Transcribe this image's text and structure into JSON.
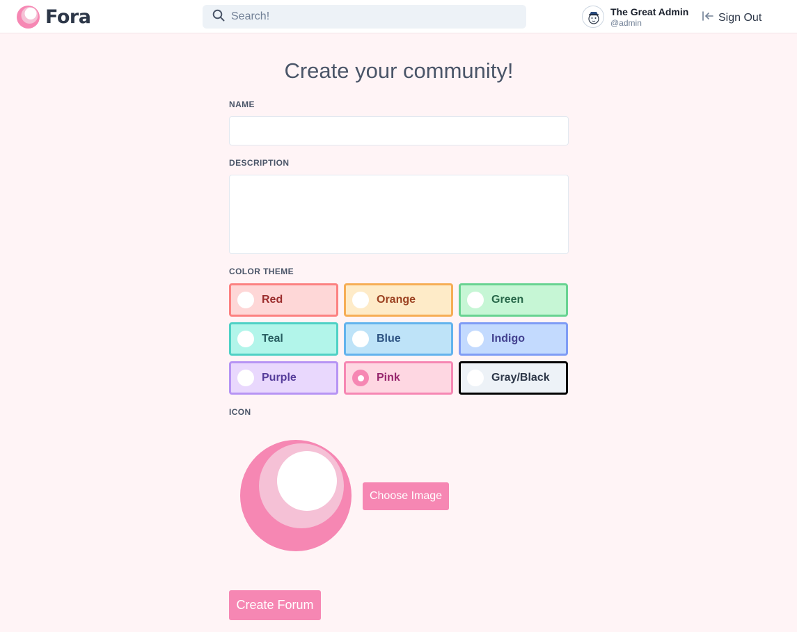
{
  "header": {
    "logo_text": "Fora",
    "logo_icon": "fora-logo-icon",
    "search_placeholder": "Search!",
    "search_icon": "search-icon",
    "user_name": "The Great Admin",
    "user_handle": "@admin",
    "signout_label": "Sign Out",
    "signout_icon": "sign-out-icon"
  },
  "form": {
    "title": "Create your community!",
    "name_label": "NAME",
    "name_value": "",
    "description_label": "DESCRIPTION",
    "description_value": "",
    "color_theme_label": "COLOR THEME",
    "themes": [
      {
        "label": "Red",
        "selected": false,
        "border": "#fc8181",
        "bg": "#fed7d7",
        "text": "#9b2c2c"
      },
      {
        "label": "Orange",
        "selected": false,
        "border": "#f6ad55",
        "bg": "#feebc8",
        "text": "#9c4221"
      },
      {
        "label": "Green",
        "selected": false,
        "border": "#68d391",
        "bg": "#c6f6d5",
        "text": "#276749"
      },
      {
        "label": "Teal",
        "selected": false,
        "border": "#4fd1c5",
        "bg": "#b2f5ea",
        "text": "#285e61"
      },
      {
        "label": "Blue",
        "selected": false,
        "border": "#63b3ed",
        "bg": "#bee3f8",
        "text": "#2c5282"
      },
      {
        "label": "Indigo",
        "selected": false,
        "border": "#7f9cf5",
        "bg": "#c3dafe",
        "text": "#434190"
      },
      {
        "label": "Purple",
        "selected": false,
        "border": "#b794f4",
        "bg": "#e9d8fd",
        "text": "#553c9a"
      },
      {
        "label": "Pink",
        "selected": true,
        "border": "#f687b3",
        "bg": "#fed7e2",
        "text": "#97266d"
      },
      {
        "label": "Gray/Black",
        "selected": false,
        "border": "#000000",
        "bg": "#edf2f7",
        "text": "#2d3748"
      }
    ],
    "icon_label": "ICON",
    "icon_preview": "community-icon-preview",
    "choose_image_label": "Choose Image",
    "submit_label": "Create Forum"
  },
  "colors": {
    "accent": "#f687b3",
    "accent_light": "#f5c1d6",
    "background": "#fff4f6"
  }
}
